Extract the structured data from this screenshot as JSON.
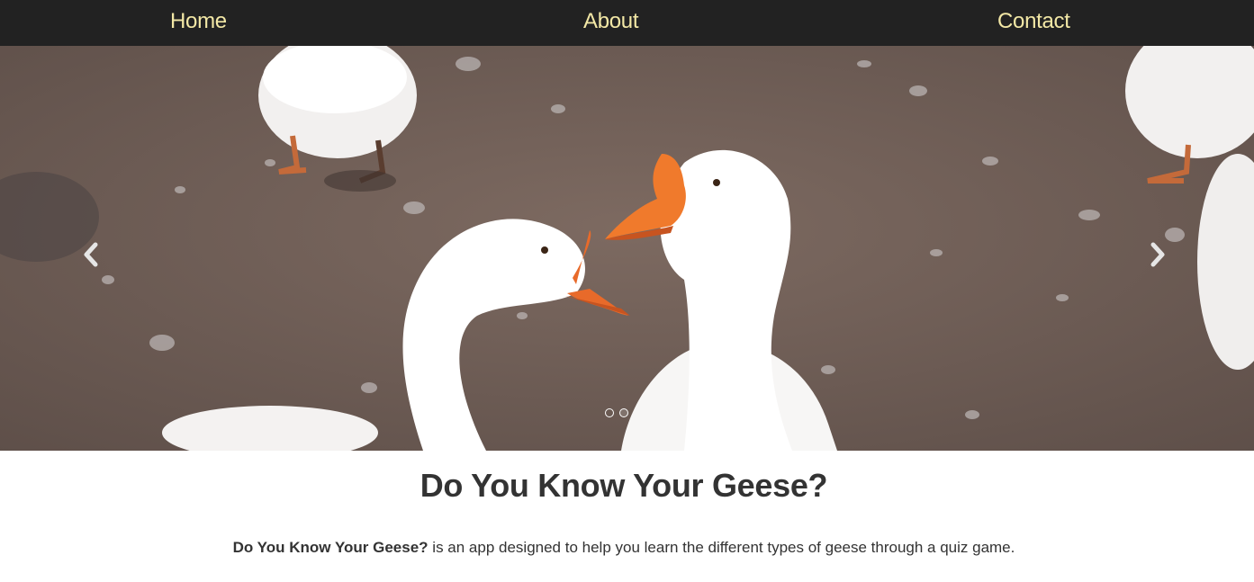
{
  "nav": {
    "home": "Home",
    "about": "About",
    "contact": "Contact"
  },
  "carousel": {
    "slide_count": 2,
    "active_slide": 1
  },
  "main": {
    "title": "Do You Know Your Geese?",
    "description_bold": "Do You Know Your Geese?",
    "description_rest": " is an app designed to help you learn the different types of geese through a quiz game."
  },
  "colors": {
    "navbar_bg": "#222222",
    "nav_link": "#f3e8a6",
    "text": "#333333"
  }
}
